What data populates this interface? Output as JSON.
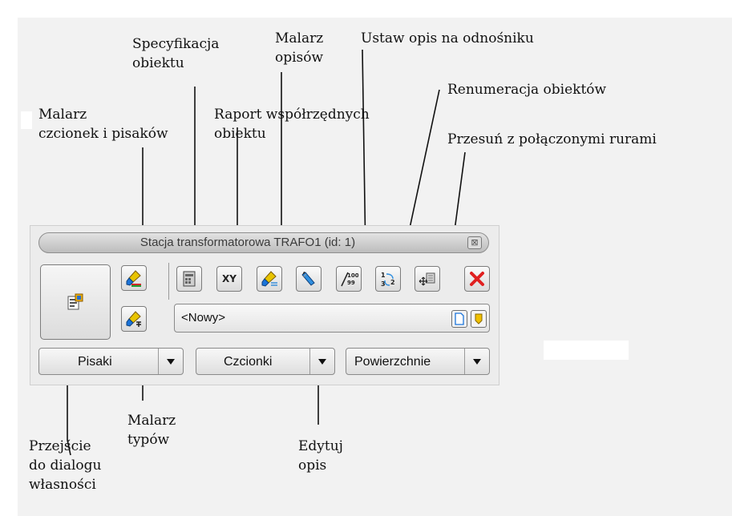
{
  "palette": {
    "title": "Stacja transformatorowa TRAFO1 (id: 1)",
    "title_close": "⊠",
    "description_value": "<Nowy>",
    "dropdowns": [
      {
        "label": "Pisaki"
      },
      {
        "label": "Czcionki"
      },
      {
        "label": "Powierzchnie"
      }
    ],
    "toolbar": {
      "xy_text": "XY",
      "numbering_text": "100\n99",
      "renumber_text": "1\n3 2"
    }
  },
  "callouts": {
    "malarz_czcionek": "Malarz\nczcionek i pisaków",
    "specyfikacja": "Specyfikacja\nobiektu",
    "raport": "Raport współrzędnych\nobiektu",
    "malarz_opisow": "Malarz\nopisów",
    "ustaw_opis": "Ustaw opis na odnośniku",
    "renumeracja": "Renumeracja obiektów",
    "przesun": "Przesuń z połączonymi rurami",
    "malarz_typow": "Malarz\ntypów",
    "przejscie": "Przejście\ndo dialogu\nwłasności",
    "edytuj": "Edytuj\nopis"
  },
  "colors": {
    "background": "#f2f2f2",
    "close_red": "#e02020",
    "brush_yellow": "#e8c400",
    "brush_blue": "#1a73d9"
  }
}
